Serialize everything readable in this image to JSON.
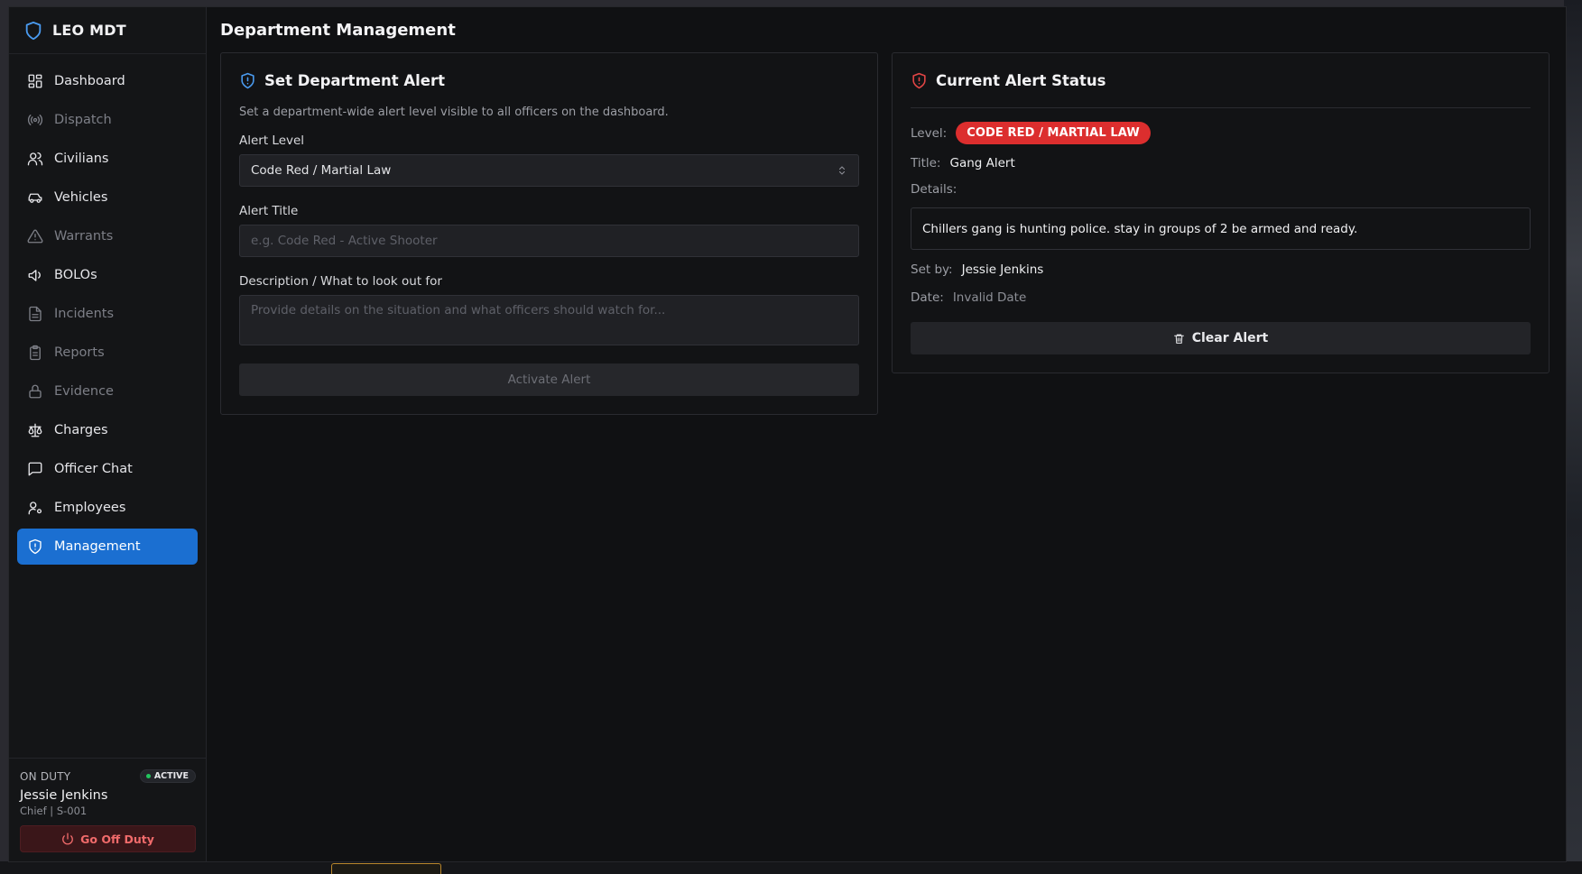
{
  "app": {
    "title": "LEO MDT"
  },
  "sidebar": {
    "items": [
      {
        "label": "Dashboard",
        "icon": "grid-icon"
      },
      {
        "label": "Dispatch",
        "icon": "radio-icon"
      },
      {
        "label": "Civilians",
        "icon": "users-icon"
      },
      {
        "label": "Vehicles",
        "icon": "car-icon"
      },
      {
        "label": "Warrants",
        "icon": "warning-triangle-icon"
      },
      {
        "label": "BOLOs",
        "icon": "megaphone-icon"
      },
      {
        "label": "Incidents",
        "icon": "file-text-icon"
      },
      {
        "label": "Reports",
        "icon": "clipboard-icon"
      },
      {
        "label": "Evidence",
        "icon": "lock-icon"
      },
      {
        "label": "Charges",
        "icon": "scale-icon"
      },
      {
        "label": "Officer Chat",
        "icon": "chat-icon"
      },
      {
        "label": "Employees",
        "icon": "user-cog-icon"
      },
      {
        "label": "Management",
        "icon": "shield-alert-icon"
      }
    ],
    "active_item": "Management",
    "duty": {
      "label": "ON DUTY",
      "badge": "ACTIVE",
      "name": "Jessie Jenkins",
      "rank": "Chief | S-001",
      "off_duty_button": "Go Off Duty"
    }
  },
  "main": {
    "page_title": "Department Management",
    "set_alert": {
      "title": "Set Department Alert",
      "description": "Set a department-wide alert level visible to all officers on the dashboard.",
      "alert_level_label": "Alert Level",
      "alert_level_value": "Code Red / Martial Law",
      "alert_title_label": "Alert Title",
      "alert_title_placeholder": "e.g. Code Red - Active Shooter",
      "description_label": "Description / What to look out for",
      "description_placeholder": "Provide details on the situation and what officers should watch for...",
      "activate_button": "Activate Alert"
    },
    "current_status": {
      "title": "Current Alert Status",
      "level_label": "Level:",
      "level_value": "CODE RED / MARTIAL LAW",
      "title_label": "Title:",
      "title_value": "Gang Alert",
      "details_label": "Details:",
      "details_value": "Chillers gang is hunting police. stay in groups of 2 be armed and ready.",
      "set_by_label": "Set by:",
      "set_by_value": "Jessie Jenkins",
      "date_label": "Date:",
      "date_value": "Invalid Date",
      "clear_button": "Clear Alert"
    }
  },
  "colors": {
    "accent": "#1b6fd1",
    "alert_red": "#dc2e2e",
    "active_green": "#22c55e"
  }
}
